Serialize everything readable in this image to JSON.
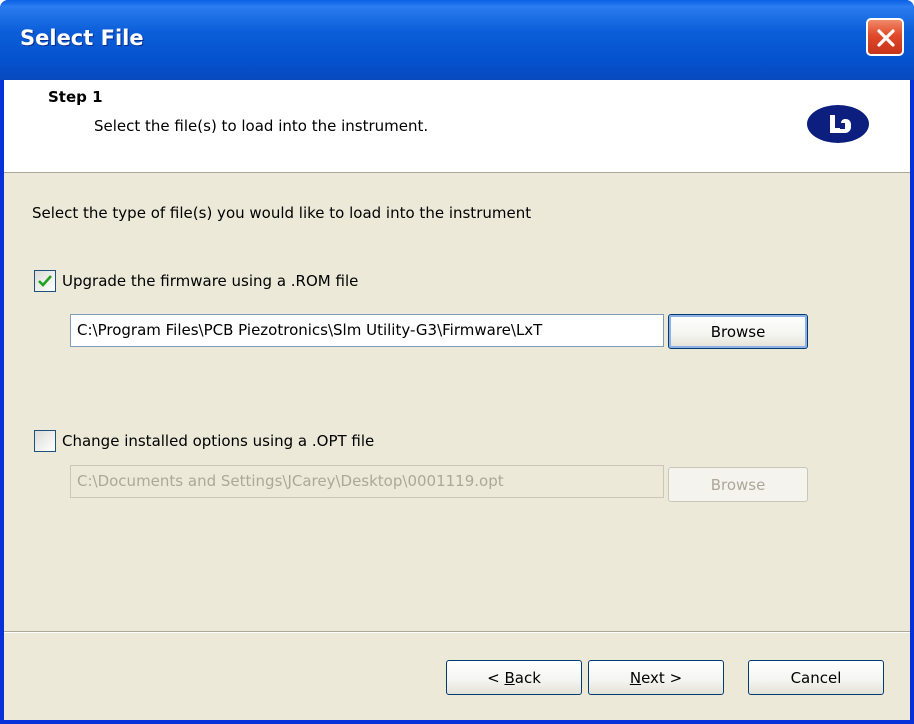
{
  "window": {
    "title": "Select File"
  },
  "header": {
    "step_title": "Step 1",
    "step_description": "Select the file(s) to load into the instrument."
  },
  "body": {
    "instruction": "Select the type of file(s) you would like to load into the instrument",
    "firmware": {
      "checked": true,
      "label": "Upgrade the firmware using a .ROM file",
      "path": "C:\\Program Files\\PCB Piezotronics\\Slm Utility-G3\\Firmware\\LxT",
      "browse_label": "Browse",
      "enabled": true
    },
    "options": {
      "checked": false,
      "label": "Change installed options using a .OPT file",
      "path": "C:\\Documents and Settings\\JCarey\\Desktop\\0001119.opt",
      "browse_label": "Browse",
      "enabled": false
    }
  },
  "footer": {
    "back_prefix": "< ",
    "back_mnemonic": "B",
    "back_rest": "ack",
    "next_mnemonic": "N",
    "next_rest": "ext >",
    "cancel_label": "Cancel"
  },
  "colors": {
    "titlebar": "#0b5ed8",
    "dialog_face": "#ece9d8",
    "logo": "#0c1f7e",
    "checkmark": "#21a121",
    "close_button": "#e0492a"
  },
  "icons": {
    "close": "close-icon",
    "logo": "company-logo-icon",
    "check": "checkmark-icon"
  }
}
